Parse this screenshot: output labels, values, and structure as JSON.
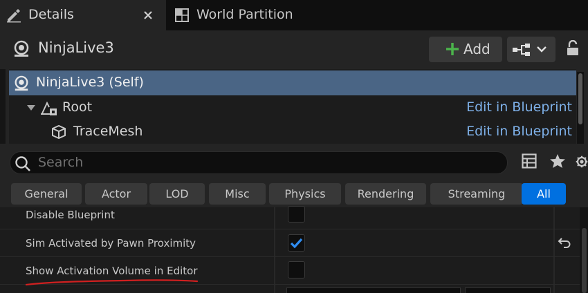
{
  "tabs": [
    {
      "label": "Details",
      "icon": "pencil-icon",
      "active": true
    },
    {
      "label": "World Partition",
      "icon": "grid-icon",
      "active": false
    }
  ],
  "header": {
    "actor_name": "NinjaLive3",
    "add_label": "Add"
  },
  "components": [
    {
      "name": "NinjaLive3 (Self)",
      "selected": true
    },
    {
      "name": "Root",
      "edit_label": "Edit in Blueprint"
    },
    {
      "name": "TraceMesh",
      "edit_label": "Edit in Blueprint"
    }
  ],
  "search": {
    "placeholder": "Search"
  },
  "filters": [
    "General",
    "Actor",
    "LOD",
    "Misc",
    "Physics",
    "Rendering",
    "Streaming",
    "All"
  ],
  "active_filter": "All",
  "properties": [
    {
      "name": "Disable Blueprint",
      "checked": false
    },
    {
      "name": "Sim Activated by Pawn Proximity",
      "checked": true
    },
    {
      "name": "Show Activation Volume in Editor",
      "checked": false
    }
  ],
  "colors": {
    "accent": "#0070e0",
    "selection": "#4a6585",
    "link": "#7eb0e8",
    "annotation": "#d02020"
  }
}
